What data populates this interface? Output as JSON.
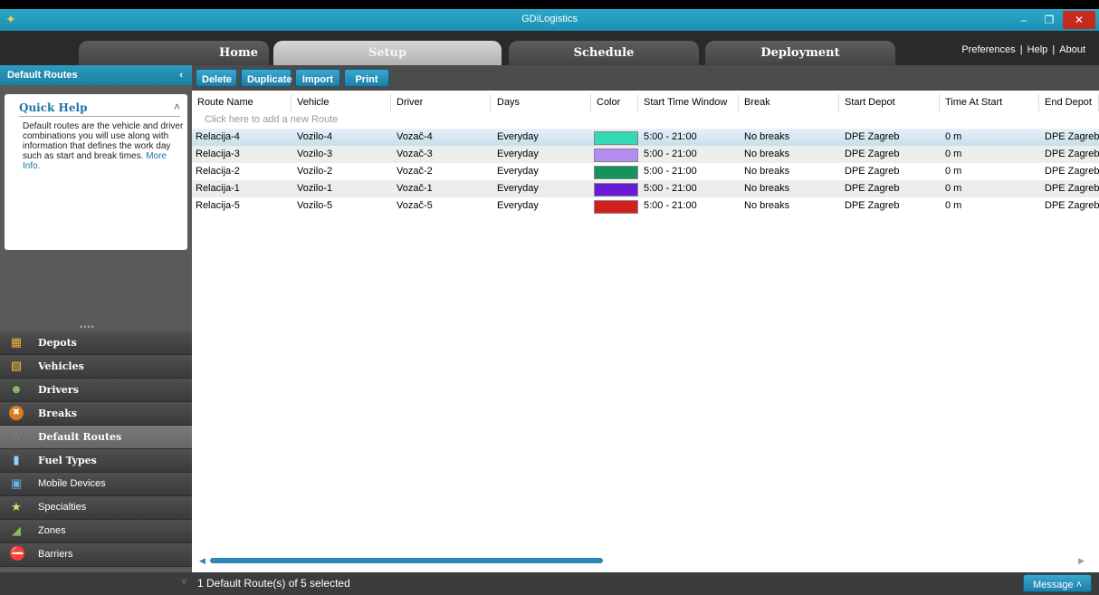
{
  "window": {
    "title": "GDiLogistics"
  },
  "tabs": [
    "Home",
    "Setup",
    "Schedule",
    "Deployment"
  ],
  "top_links": {
    "preferences": "Preferences",
    "help": "Help",
    "about": "About",
    "sep": "|"
  },
  "sidebar": {
    "header": "Default Routes",
    "collapse_glyph": "‹",
    "quick_help": {
      "title": "Quick Help",
      "text": "Default routes are the vehicle and driver combinations you will use along with information that defines the work day such as start and break times.",
      "link": "More Info."
    },
    "items": [
      {
        "label": "Depots",
        "icon": "depot-icon"
      },
      {
        "label": "Vehicles",
        "icon": "vehicle-icon"
      },
      {
        "label": "Drivers",
        "icon": "driver-icon"
      },
      {
        "label": "Breaks",
        "icon": "break-icon"
      },
      {
        "label": "Default Routes",
        "icon": "route-icon"
      },
      {
        "label": "Fuel Types",
        "icon": "fuel-icon"
      },
      {
        "label": "Mobile Devices",
        "icon": "mobile-device-icon"
      },
      {
        "label": "Specialties",
        "icon": "star-icon"
      },
      {
        "label": "Zones",
        "icon": "zone-icon"
      },
      {
        "label": "Barriers",
        "icon": "barrier-icon"
      }
    ]
  },
  "toolbar": {
    "delete": "Delete",
    "duplicate": "Duplicate",
    "import": "Import",
    "print": "Print"
  },
  "table": {
    "columns": [
      "Route Name",
      "Vehicle",
      "Driver",
      "Days",
      "Color",
      "Start Time Window",
      "Break",
      "Start Depot",
      "Time At Start",
      "End Depot"
    ],
    "add_hint": "Click here to add a new Route",
    "rows": [
      {
        "route": "Relacija-4",
        "vehicle": "Vozilo-4",
        "driver": "Vozač-4",
        "days": "Everyday",
        "color": "#33d9b2",
        "window": "5:00 - 21:00",
        "break": "No breaks",
        "start_depot": "DPE Zagreb",
        "time_at_start": "0 m",
        "end_depot": "DPE Zagreb"
      },
      {
        "route": "Relacija-3",
        "vehicle": "Vozilo-3",
        "driver": "Vozač-3",
        "days": "Everyday",
        "color": "#b48cf0",
        "window": "5:00 - 21:00",
        "break": "No breaks",
        "start_depot": "DPE Zagreb",
        "time_at_start": "0 m",
        "end_depot": "DPE Zagreb"
      },
      {
        "route": "Relacija-2",
        "vehicle": "Vozilo-2",
        "driver": "Vozač-2",
        "days": "Everyday",
        "color": "#14945a",
        "window": "5:00 - 21:00",
        "break": "No breaks",
        "start_depot": "DPE Zagreb",
        "time_at_start": "0 m",
        "end_depot": "DPE Zagreb"
      },
      {
        "route": "Relacija-1",
        "vehicle": "Vozilo-1",
        "driver": "Vozač-1",
        "days": "Everyday",
        "color": "#6a1bd8",
        "window": "5:00 - 21:00",
        "break": "No breaks",
        "start_depot": "DPE Zagreb",
        "time_at_start": "0 m",
        "end_depot": "DPE Zagreb"
      },
      {
        "route": "Relacija-5",
        "vehicle": "Vozilo-5",
        "driver": "Vozač-5",
        "days": "Everyday",
        "color": "#d41e1e",
        "window": "5:00 - 21:00",
        "break": "No breaks",
        "start_depot": "DPE Zagreb",
        "time_at_start": "0 m",
        "end_depot": "DPE Zagreb"
      }
    ]
  },
  "status": {
    "text": "1 Default Route(s) of 5 selected",
    "message_button": "Message"
  }
}
